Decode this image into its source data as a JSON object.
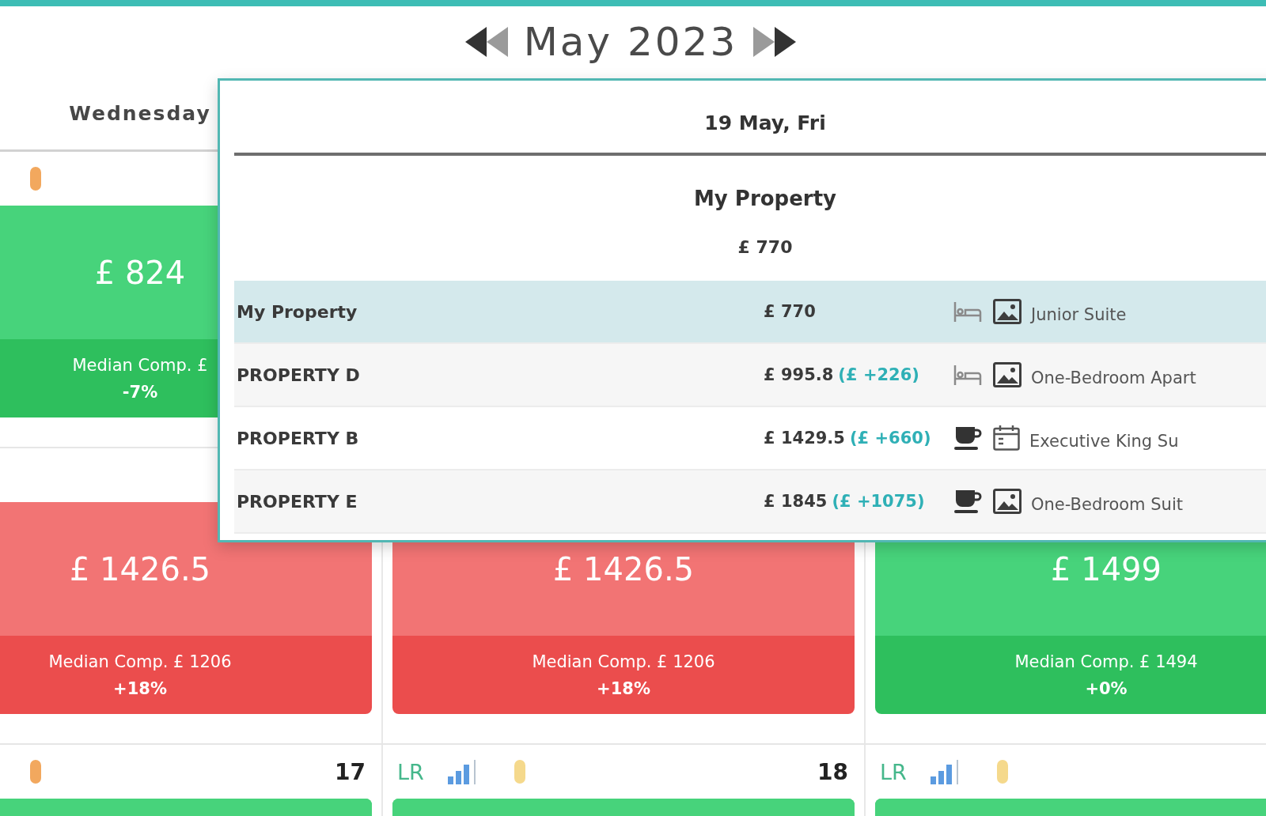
{
  "month_nav": {
    "title": "May 2023"
  },
  "weekday_headers": [
    {
      "label": "Wednesday"
    }
  ],
  "weeks": [
    {
      "days": [
        {
          "markers": [
            {
              "kind": "pill",
              "color": "#f2a85e"
            }
          ],
          "card": {
            "above_median": false,
            "price": "£ 824",
            "median": "Median Comp. £",
            "change": "-7%"
          }
        }
      ]
    },
    {
      "days": [
        {
          "card": {
            "above_median": true,
            "price": "£ 1426.5",
            "median": "Median Comp. £ 1206",
            "change": "+18%"
          }
        },
        {
          "card": {
            "above_median": true,
            "price": "£ 1426.5",
            "median": "Median Comp. £ 1206",
            "change": "+18%"
          }
        },
        {
          "card": {
            "above_median": false,
            "price": "£ 1499",
            "median": "Median Comp. £ 1494",
            "change": "+0%"
          }
        }
      ]
    },
    {
      "days": [
        {
          "markers": [
            {
              "kind": "pill",
              "color": "#f2a85e"
            }
          ],
          "number": "17",
          "card": {
            "above_median": false
          }
        },
        {
          "markers": [
            {
              "kind": "text",
              "text": "LR"
            },
            {
              "kind": "chart"
            },
            {
              "kind": "pill",
              "color": "#f5d98c"
            }
          ],
          "number": "18",
          "card": {
            "above_median": false
          }
        },
        {
          "markers": [
            {
              "kind": "text",
              "text": "LR"
            },
            {
              "kind": "chart"
            },
            {
              "kind": "pill",
              "color": "#f5d98c"
            }
          ],
          "card": {
            "above_median": false
          }
        }
      ]
    }
  ],
  "day_popup": {
    "title": "19 May, Fri",
    "property": "My Property",
    "price": "£ 770",
    "rows": [
      {
        "name": "My Property",
        "price": "£ 770",
        "icons": [
          {
            "kind": "bed"
          },
          {
            "kind": "photo"
          }
        ],
        "room": "Junior Suite",
        "highlighted": true
      },
      {
        "name": "PROPERTY D",
        "price": "£ 995.8",
        "difference": "(£ +226)",
        "icons": [
          {
            "kind": "bed"
          },
          {
            "kind": "photo"
          }
        ],
        "room": "One-Bedroom Apart",
        "highlighted": false
      },
      {
        "name": "PROPERTY B",
        "price": "£ 1429.5",
        "difference": "(£ +660)",
        "icons": [
          {
            "kind": "cup"
          },
          {
            "kind": "calendar"
          }
        ],
        "room": "Executive King Su",
        "highlighted": false
      },
      {
        "name": "PROPERTY E",
        "price": "£ 1845",
        "difference": "(£ +1075)",
        "icons": [
          {
            "kind": "cup"
          },
          {
            "kind": "photo"
          }
        ],
        "room": "One-Bedroom Suit",
        "highlighted": false
      }
    ]
  }
}
